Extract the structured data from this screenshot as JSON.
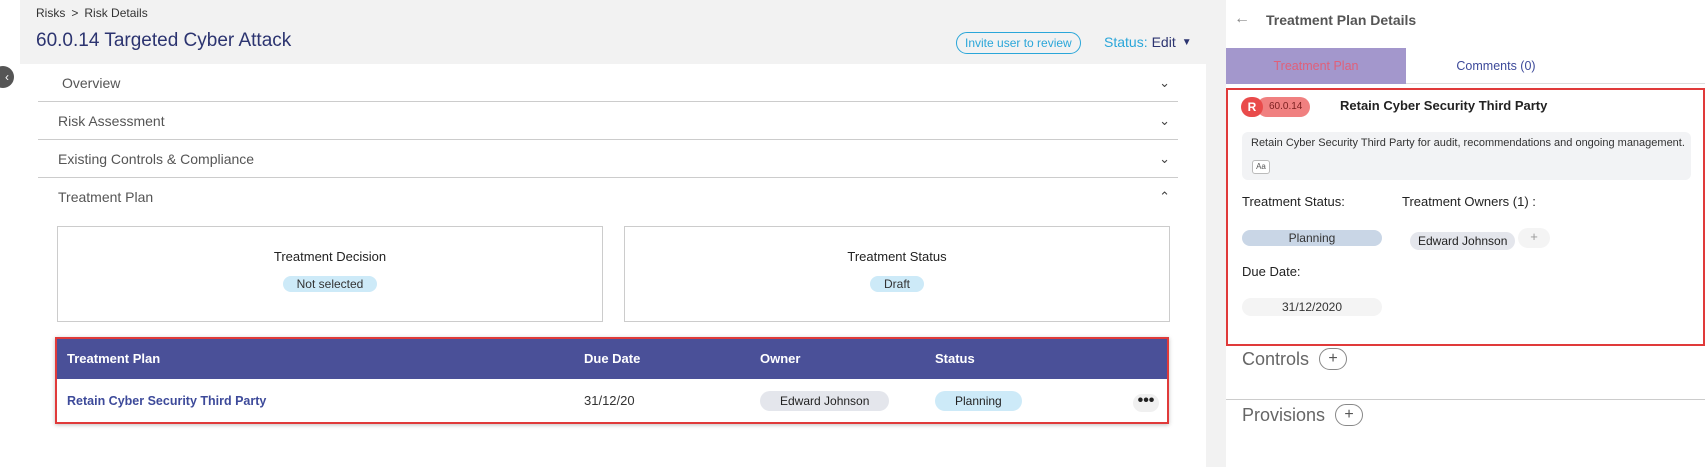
{
  "breadcrumb": {
    "parent": "Risks",
    "separator": ">",
    "current": "Risk Details"
  },
  "page": {
    "title": "60.0.14 Targeted Cyber Attack"
  },
  "header": {
    "invite_label": "Invite user to review",
    "status_label": "Status:",
    "status_value": "Edit"
  },
  "sections": {
    "overview": "Overview",
    "risk_assessment": "Risk Assessment",
    "existing_controls": "Existing Controls & Compliance",
    "treatment_plan": "Treatment Plan"
  },
  "cards": {
    "decision": {
      "title": "Treatment Decision",
      "value": "Not selected"
    },
    "status": {
      "title": "Treatment Status",
      "value": "Draft"
    }
  },
  "table": {
    "headers": [
      "Treatment Plan",
      "Due Date",
      "Owner",
      "Status"
    ],
    "rows": [
      {
        "plan": "Retain Cyber Security Third Party",
        "due": "31/12/20",
        "owner": "Edward Johnson",
        "status": "Planning"
      }
    ]
  },
  "panel": {
    "title": "Treatment Plan Details",
    "tabs": [
      "Treatment Plan",
      "Comments (0)"
    ],
    "badge_letter": "R",
    "badge_code": "60.0.14",
    "plan_title": "Retain Cyber Security Third Party",
    "description": "Retain Cyber Security Third Party for audit, recommendations and ongoing management.",
    "format_icon_label": "Aa",
    "status_label": "Treatment Status:",
    "owners_label": "Treatment Owners (1) :",
    "status_value": "Planning",
    "owner_value": "Edward Johnson",
    "add_label": "+",
    "due_label": "Due Date:",
    "due_value": "31/12/2020",
    "controls_label": "Controls",
    "provisions_label": "Provisions"
  },
  "colors": {
    "accent": "#2aa6d9",
    "table_header": "#4a5098",
    "highlight": "#e03a3a",
    "title": "#2c3470"
  }
}
